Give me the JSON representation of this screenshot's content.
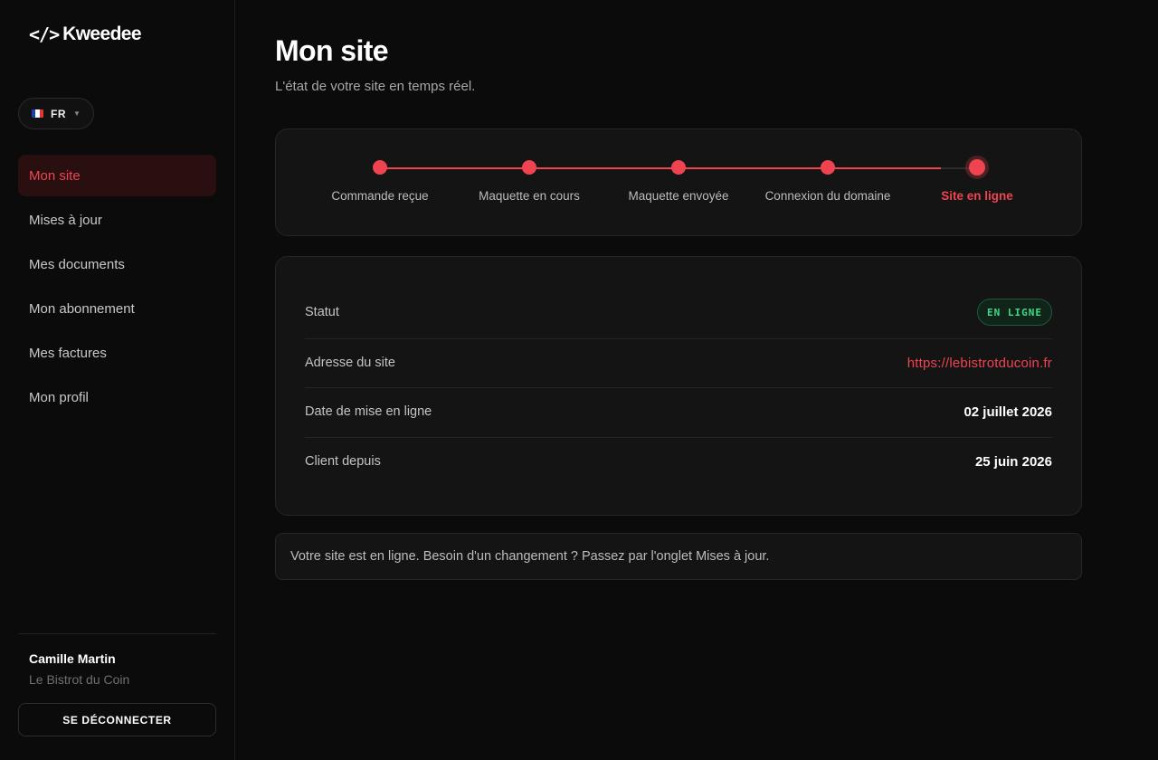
{
  "brand": {
    "logo_glyph": "</>",
    "logo_text": "Kweedee"
  },
  "language": {
    "code": "FR",
    "flag_colors": [
      "#1f3fb0",
      "#ffffff",
      "#e3342f"
    ]
  },
  "nav": {
    "items": [
      {
        "label": "Mon site",
        "active": true
      },
      {
        "label": "Mises à jour"
      },
      {
        "label": "Mes documents"
      },
      {
        "label": "Mon abonnement"
      },
      {
        "label": "Mes factures"
      },
      {
        "label": "Mon profil"
      }
    ]
  },
  "user": {
    "name": "Camille Martin",
    "company": "Le Bistrot du Coin"
  },
  "logout_label": "SE DÉCONNECTER",
  "page": {
    "title": "Mon site",
    "subtitle": "L'état de votre site en temps réel."
  },
  "progress": {
    "steps": [
      "Commande reçue",
      "Maquette en cours",
      "Maquette envoyée",
      "Connexion du domaine",
      "Site en ligne"
    ],
    "current_step": 5
  },
  "details": {
    "status_label": "Statut",
    "status_value": "EN LIGNE",
    "address_label": "Adresse du site",
    "address_value": "https://lebistrotducoin.fr",
    "online_date_label": "Date de mise en ligne",
    "online_date_value": "02 juillet 2026",
    "client_since_label": "Client depuis",
    "client_since_value": "25 juin 2026"
  },
  "note": "Votre site est en ligne. Besoin d'un changement ? Passez par l'onglet Mises à jour.",
  "colors": {
    "accent": "#ef4450",
    "status_online": "#3ddc84",
    "background": "#0b0b0b",
    "card": "#141414"
  }
}
